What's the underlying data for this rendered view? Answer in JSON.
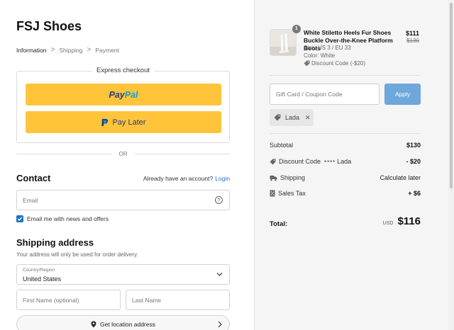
{
  "brand": "FSJ Shoes",
  "breadcrumb": {
    "items": [
      "Information",
      "Shipping",
      "Payment"
    ],
    "separator": ">"
  },
  "express": {
    "title": "Express checkout",
    "paypal_logo_a": "Pay",
    "paypal_logo_b": "Pal",
    "pay_later_label": "Pay Later"
  },
  "divider_or": "OR",
  "contact": {
    "heading": "Contact",
    "have_account": "Already have an account?",
    "login_label": "Login",
    "email_placeholder": "Email",
    "help_glyph": "?",
    "newsletter_label": "Email me with news and offers",
    "newsletter_checked": true
  },
  "shipping": {
    "heading": "Shipping address",
    "note": "Your address will only be used for order delivery.",
    "country_label": "Country/Region",
    "country_value": "United States",
    "first_name_placeholder": "First Name (optional)",
    "last_name_placeholder": "Last Name",
    "location_button": "Get location address"
  },
  "order": {
    "quantity": "1",
    "product_name": "White Stiletto Heels Fur Shoes Buckle Over-the-Knee Platform Boots",
    "size": "Size: US 3 / EU 33",
    "color": "Color: White",
    "discount_note": "Discount Code (-$20)",
    "price": "$111",
    "original_price": "$130"
  },
  "coupon": {
    "placeholder": "Gift Card / Coupon Code",
    "apply_label": "Apply",
    "applied_tag": "Lada",
    "remove_glyph": "✕"
  },
  "summary": {
    "subtotal_label": "Subtotal",
    "subtotal_value": "$130",
    "discount_label": "Discount Code",
    "discount_dots": "●●●●",
    "discount_code": "Lada",
    "discount_value": "- $20",
    "shipping_label": "Shipping",
    "shipping_value": "Calculate later",
    "tax_label": "Sales Tax",
    "tax_value": "+ $6",
    "total_label": "Total:",
    "currency": "USD",
    "total_value": "$116"
  },
  "colors": {
    "paypal_yellow": "#ffc439",
    "link_blue": "#1f6fc5",
    "apply_button": "#6ea7db",
    "summary_bg": "#f5f5f5"
  },
  "icons": [
    "chevron-right-icon",
    "paypal-icon",
    "help-icon",
    "check-icon",
    "chevron-down-icon",
    "location-pin-icon",
    "tag-icon",
    "close-icon",
    "truck-icon",
    "tax-receipt-icon"
  ]
}
